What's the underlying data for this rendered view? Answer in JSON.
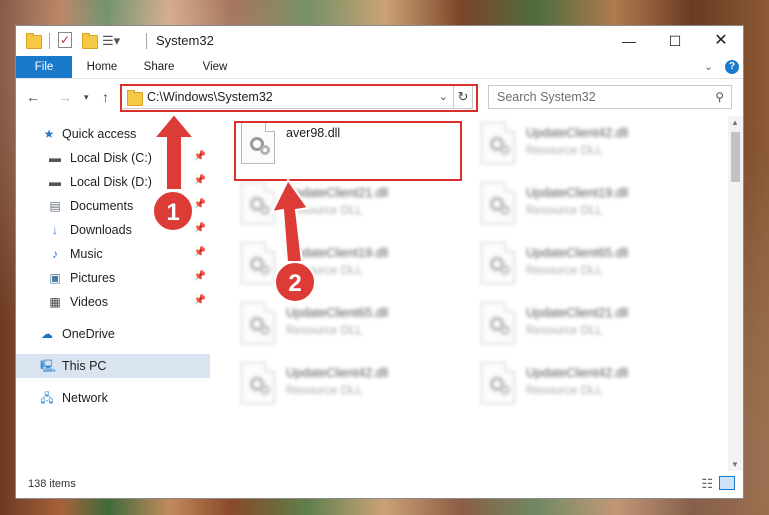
{
  "window": {
    "title": "System32"
  },
  "ribbon": {
    "tabs": [
      "File",
      "Home",
      "Share",
      "View"
    ]
  },
  "address": {
    "path": "C:\\Windows\\System32",
    "search_placeholder": "Search System32"
  },
  "nav": {
    "items": [
      {
        "label": "Quick access",
        "icon": "star-icon"
      },
      {
        "label": "Local Disk (C:)",
        "icon": "drive-icon"
      },
      {
        "label": "Local Disk (D:)",
        "icon": "drive-icon"
      },
      {
        "label": "Documents",
        "icon": "documents-icon"
      },
      {
        "label": "Downloads",
        "icon": "downloads-icon"
      },
      {
        "label": "Music",
        "icon": "music-icon"
      },
      {
        "label": "Pictures",
        "icon": "pictures-icon"
      },
      {
        "label": "Videos",
        "icon": "videos-icon"
      },
      {
        "label": "OneDrive",
        "icon": "cloud-icon"
      },
      {
        "label": "This PC",
        "icon": "computer-icon"
      },
      {
        "label": "Network",
        "icon": "network-icon"
      }
    ]
  },
  "files": [
    {
      "name": "aver98.dll",
      "type": ""
    },
    {
      "name": "UpdateClient42.dll",
      "type": "Resource DLL"
    },
    {
      "name": "UpdateClient21.dll",
      "type": "Resource DLL"
    },
    {
      "name": "UpdateClient19.dll",
      "type": "Resource DLL"
    },
    {
      "name": "UpdateClient19.dll",
      "type": "Resource DLL"
    },
    {
      "name": "UpdateClient65.dll",
      "type": "Resource DLL"
    },
    {
      "name": "UpdateClient65.dll",
      "type": "Resource DLL"
    },
    {
      "name": "UpdateClient21.dll",
      "type": "Resource DLL"
    },
    {
      "name": "UpdateClient42.dll",
      "type": "Resource DLL"
    },
    {
      "name": "UpdateClient42.dll",
      "type": "Resource DLL"
    }
  ],
  "status": {
    "items": "138 items"
  },
  "callouts": [
    "1",
    "2"
  ],
  "colors": {
    "accent": "#1979ca",
    "highlight": "#d9302c"
  }
}
